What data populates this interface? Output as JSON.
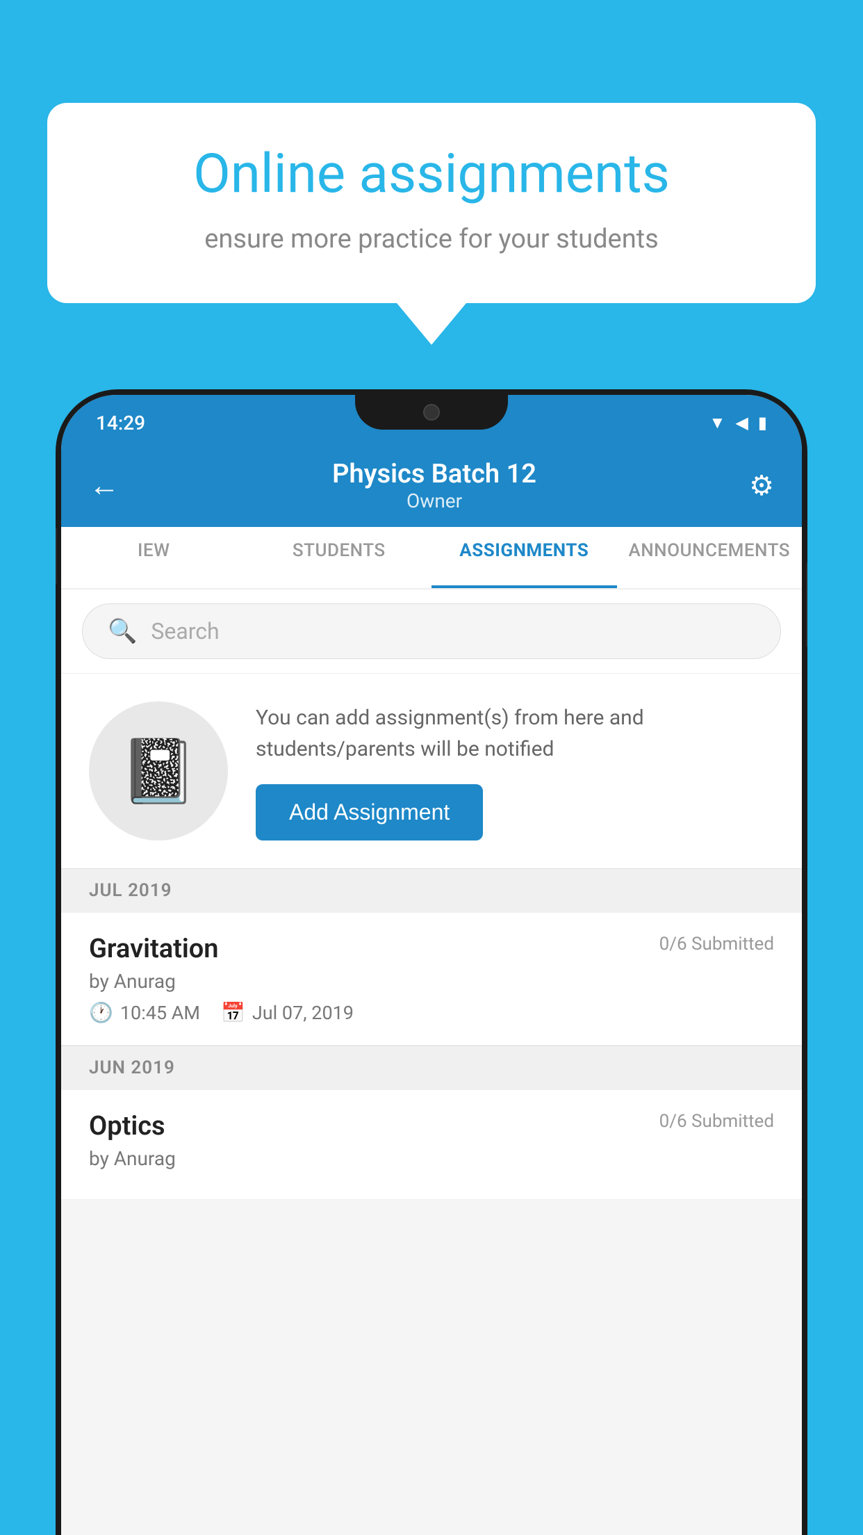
{
  "background_color": "#29b6e8",
  "speech_bubble": {
    "title": "Online assignments",
    "subtitle": "ensure more practice for your students"
  },
  "status_bar": {
    "time": "14:29",
    "wifi": "▲",
    "signal": "▲",
    "battery": "▮"
  },
  "app_bar": {
    "title": "Physics Batch 12",
    "subtitle": "Owner",
    "back_label": "←",
    "settings_label": "⚙"
  },
  "tabs": [
    {
      "label": "IEW",
      "active": false
    },
    {
      "label": "STUDENTS",
      "active": false
    },
    {
      "label": "ASSIGNMENTS",
      "active": true
    },
    {
      "label": "ANNOUNCEMENTS",
      "active": false
    }
  ],
  "search": {
    "placeholder": "Search"
  },
  "info_card": {
    "icon": "📒",
    "text": "You can add assignment(s) from here and students/parents will be notified",
    "button_label": "Add Assignment"
  },
  "assignment_groups": [
    {
      "month_label": "JUL 2019",
      "assignments": [
        {
          "name": "Gravitation",
          "submitted": "0/6 Submitted",
          "author": "by Anurag",
          "time": "10:45 AM",
          "date": "Jul 07, 2019"
        }
      ]
    },
    {
      "month_label": "JUN 2019",
      "assignments": [
        {
          "name": "Optics",
          "submitted": "0/6 Submitted",
          "author": "by Anurag",
          "time": "",
          "date": ""
        }
      ]
    }
  ]
}
